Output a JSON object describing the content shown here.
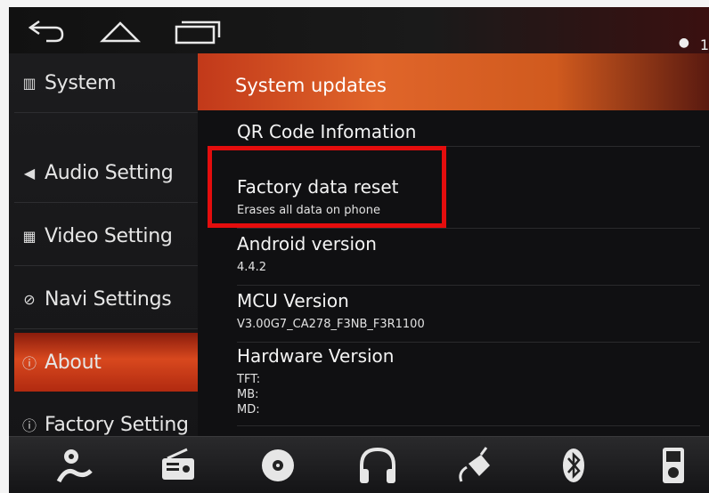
{
  "topbar": {
    "back_icon": "back-arrow-icon",
    "home_icon": "home-icon",
    "recents_icon": "recent-apps-icon",
    "status_location_icon": "location-pin-icon",
    "clock_partial": "1"
  },
  "sidebar": {
    "items": [
      {
        "icon": "system-icon",
        "label": "System"
      },
      {
        "icon": "speaker-icon",
        "label": "Audio Setting"
      },
      {
        "icon": "film-icon",
        "label": "Video Setting"
      },
      {
        "icon": "compass-icon",
        "label": "Navi Settings"
      },
      {
        "icon": "info-icon",
        "label": "About",
        "active": true
      },
      {
        "icon": "info-icon",
        "label": "Factory Setting"
      }
    ]
  },
  "content": {
    "header_title": "System updates",
    "rows": [
      {
        "title": "QR Code Infomation",
        "subtitle": ""
      },
      {
        "title": "Factory data reset",
        "subtitle": "Erases all data on phone"
      },
      {
        "title": "Android version",
        "subtitle": "4.4.2"
      },
      {
        "title": "MCU Version",
        "subtitle": "V3.00G7_CA278_F3NB_F3R1100"
      },
      {
        "title": "Hardware Version",
        "subtitle_lines": [
          "TFT:",
          "MB:",
          "MD:"
        ]
      }
    ]
  },
  "highlight": {
    "color": "#e40d0d",
    "target": "Factory data reset"
  },
  "dock": {
    "icons": [
      "navigation-icon",
      "radio-icon",
      "disc-icon",
      "headphones-icon",
      "steering-link-icon",
      "bluetooth-icon",
      "media-player-icon"
    ]
  },
  "colors": {
    "accent": "#d8481e",
    "background": "#0b0b0c"
  }
}
